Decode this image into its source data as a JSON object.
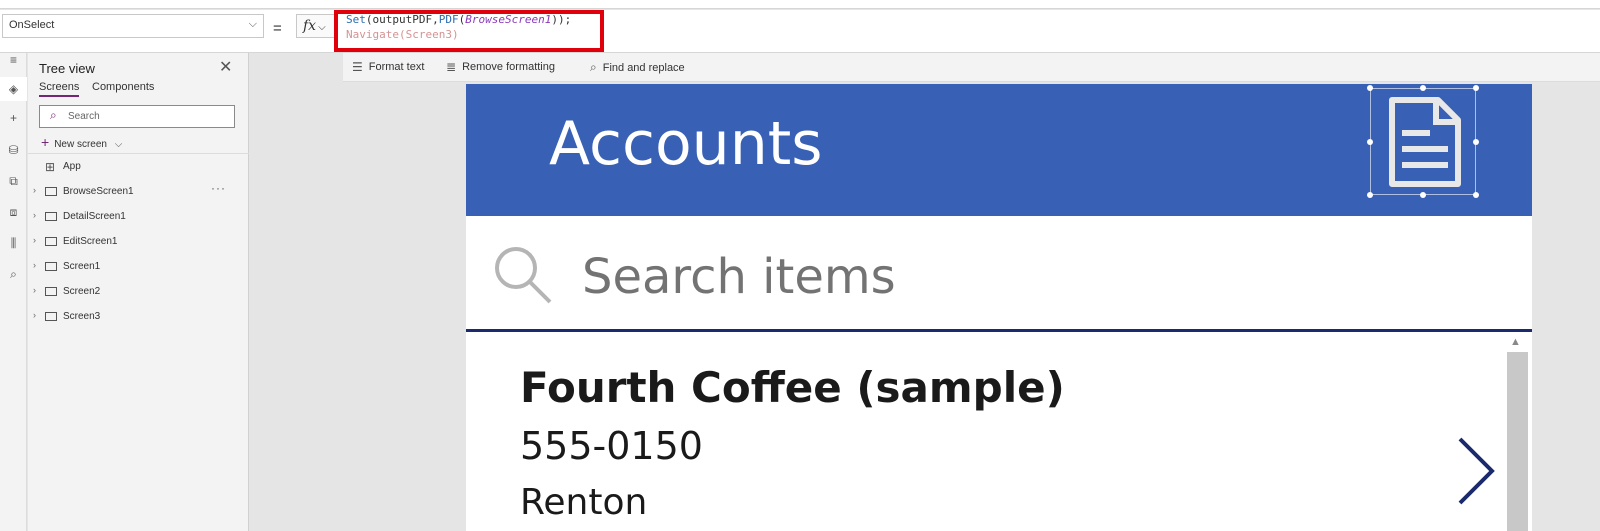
{
  "formula_bar": {
    "property": "OnSelect",
    "equals": "=",
    "fx": "fx",
    "code_line1": {
      "fn1": "Set",
      "p1": "(outputPDF,",
      "fn2": "PDF",
      "p2": "(",
      "arg": "BrowseScreen1",
      "p3": "));"
    },
    "code_line2": "Navigate(Screen3)"
  },
  "toolbar": {
    "format_text": "Format text",
    "remove_formatting": "Remove formatting",
    "find_replace": "Find and replace"
  },
  "tree": {
    "title": "Tree view",
    "tabs": [
      "Screens",
      "Components"
    ],
    "search_placeholder": "Search",
    "new_screen": "New screen",
    "app": "App",
    "screens": [
      "BrowseScreen1",
      "DetailScreen1",
      "EditScreen1",
      "Screen1",
      "Screen2",
      "Screen3"
    ],
    "more": "···"
  },
  "canvas": {
    "header_title": "Accounts",
    "search_placeholder": "Search items",
    "item": {
      "title": "Fourth Coffee (sample)",
      "phone": "555-0150",
      "city": "Renton"
    }
  },
  "colors": {
    "header": "#3860b4",
    "highlight": "#e0000b",
    "accent": "#742774"
  }
}
